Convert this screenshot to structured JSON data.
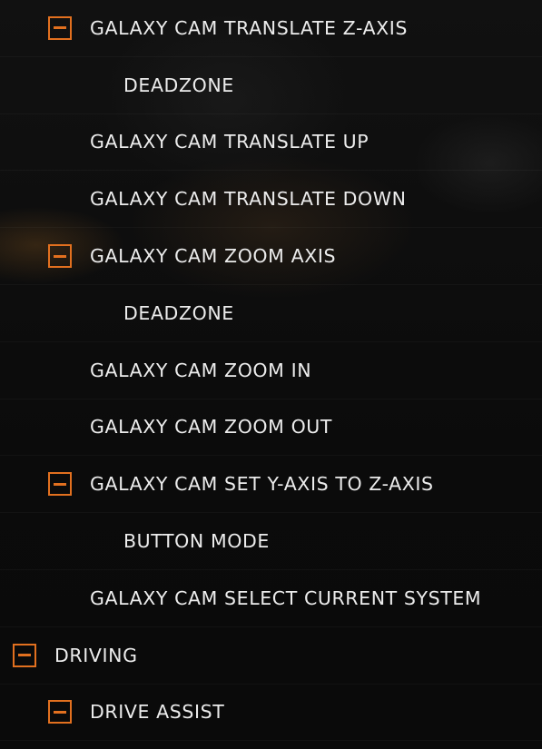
{
  "bindings_list": {
    "rows": [
      {
        "label": "GALAXY CAM TRANSLATE Z-AXIS",
        "toggle": "collapse"
      },
      {
        "label": "DEADZONE"
      },
      {
        "label": "GALAXY CAM TRANSLATE UP"
      },
      {
        "label": "GALAXY CAM TRANSLATE DOWN"
      },
      {
        "label": "GALAXY CAM ZOOM AXIS",
        "toggle": "collapse"
      },
      {
        "label": "DEADZONE"
      },
      {
        "label": "GALAXY CAM ZOOM IN"
      },
      {
        "label": "GALAXY CAM ZOOM OUT"
      },
      {
        "label": "GALAXY CAM SET Y-AXIS TO Z-AXIS",
        "toggle": "collapse"
      },
      {
        "label": "BUTTON MODE"
      },
      {
        "label": "GALAXY CAM SELECT CURRENT SYSTEM"
      },
      {
        "label": "DRIVING",
        "toggle": "collapse"
      },
      {
        "label": "DRIVE ASSIST",
        "toggle": "collapse"
      }
    ]
  },
  "icons": {
    "collapse": "minus-square-icon"
  },
  "colors": {
    "accent": "#e2701f",
    "text": "#ececec",
    "background": "#0c0c0c"
  }
}
